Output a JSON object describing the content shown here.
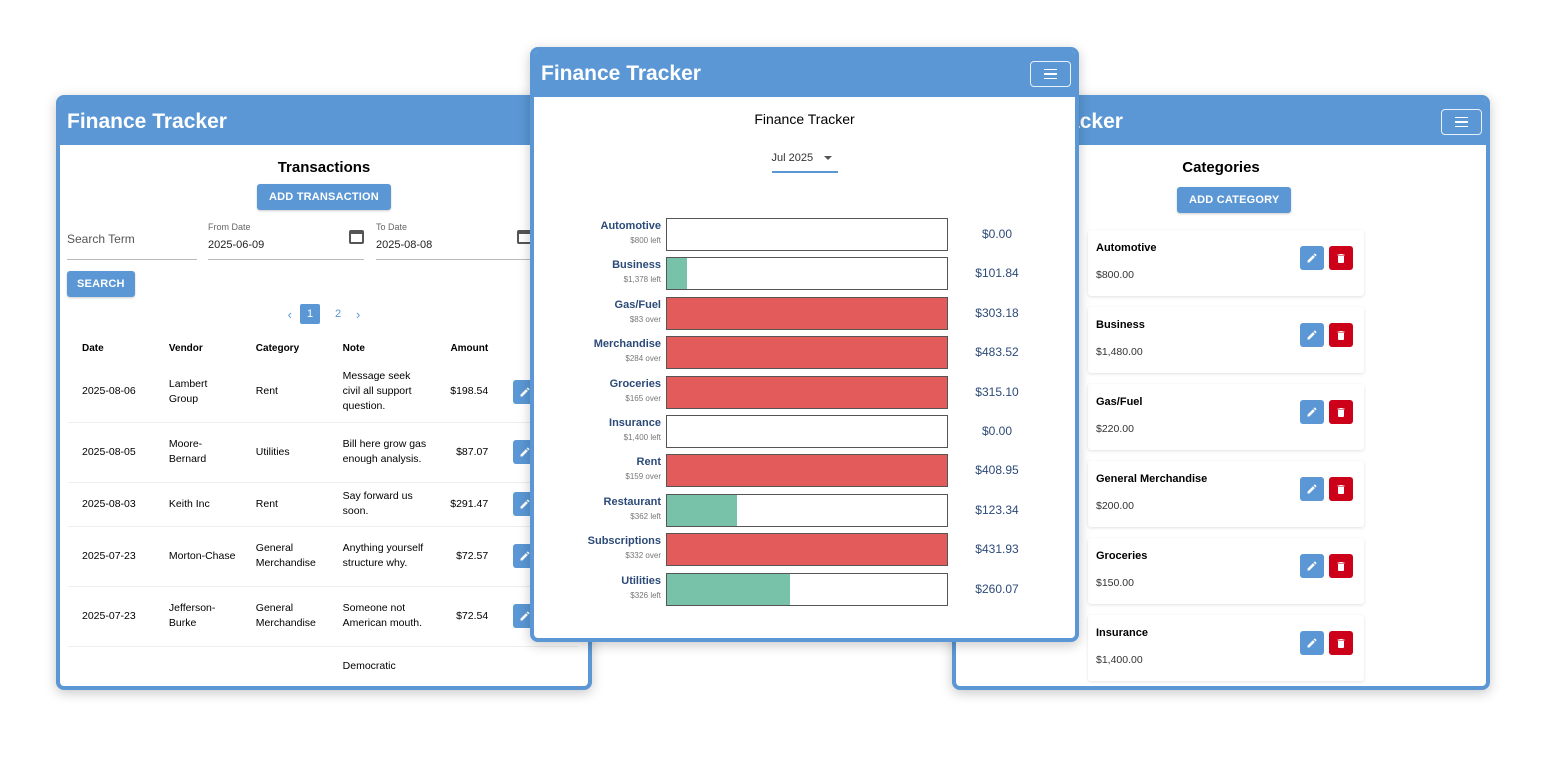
{
  "app_title": "Finance Tracker",
  "colors": {
    "accent": "#5a97d4",
    "delete": "#cc0019",
    "over": "#e35b5b",
    "under": "#79c2aa"
  },
  "transactions_window": {
    "title": "Finance Tracker",
    "heading": "Transactions",
    "add_button": "ADD TRANSACTION",
    "search": {
      "placeholder": "Search Term"
    },
    "from_date": {
      "label": "From Date",
      "value": "2025-06-09"
    },
    "to_date": {
      "label": "To Date",
      "value": "2025-08-08"
    },
    "search_button": "SEARCH",
    "pagination": {
      "pages": [
        "1",
        "2"
      ],
      "current": "1"
    },
    "columns": [
      "Date",
      "Vendor",
      "Category",
      "Note",
      "Amount"
    ],
    "rows": [
      {
        "date": "2025-08-06",
        "vendor": "Lambert Group",
        "category": "Rent",
        "note": "Message seek civil all support question.",
        "amount": "$198.54"
      },
      {
        "date": "2025-08-05",
        "vendor": "Moore-Bernard",
        "category": "Utilities",
        "note": "Bill here grow gas enough analysis.",
        "amount": "$87.07"
      },
      {
        "date": "2025-08-03",
        "vendor": "Keith Inc",
        "category": "Rent",
        "note": "Say forward us soon.",
        "amount": "$291.47"
      },
      {
        "date": "2025-07-23",
        "vendor": "Morton-Chase",
        "category": "General Merchandise",
        "note": "Anything yourself structure why.",
        "amount": "$72.57"
      },
      {
        "date": "2025-07-23",
        "vendor": "Jefferson-Burke",
        "category": "General Merchandise",
        "note": "Someone not American mouth.",
        "amount": "$72.54"
      },
      {
        "date": "",
        "vendor": "",
        "category": "",
        "note": "Democratic",
        "amount": ""
      }
    ]
  },
  "budget_window": {
    "title": "Finance Tracker",
    "heading": "Finance Tracker",
    "month": "Jul 2025",
    "rows": [
      {
        "name": "Automotive",
        "sub": "$800 left",
        "spent": "$0.00",
        "fraction": 0.0,
        "status": "under"
      },
      {
        "name": "Business",
        "sub": "$1,378 left",
        "spent": "$101.84",
        "fraction": 0.07,
        "status": "under"
      },
      {
        "name": "Gas/Fuel",
        "sub": "$83 over",
        "spent": "$303.18",
        "fraction": 1.0,
        "status": "over"
      },
      {
        "name": "Merchandise",
        "sub": "$284 over",
        "spent": "$483.52",
        "fraction": 1.0,
        "status": "over"
      },
      {
        "name": "Groceries",
        "sub": "$165 over",
        "spent": "$315.10",
        "fraction": 1.0,
        "status": "over"
      },
      {
        "name": "Insurance",
        "sub": "$1,400 left",
        "spent": "$0.00",
        "fraction": 0.0,
        "status": "under"
      },
      {
        "name": "Rent",
        "sub": "$159 over",
        "spent": "$408.95",
        "fraction": 1.0,
        "status": "over"
      },
      {
        "name": "Restaurant",
        "sub": "$362 left",
        "spent": "$123.34",
        "fraction": 0.25,
        "status": "under"
      },
      {
        "name": "Subscriptions",
        "sub": "$332 over",
        "spent": "$431.93",
        "fraction": 1.0,
        "status": "over"
      },
      {
        "name": "Utilities",
        "sub": "$326 left",
        "spent": "$260.07",
        "fraction": 0.44,
        "status": "under"
      }
    ]
  },
  "categories_window": {
    "title": "Finance Tracker",
    "heading": "Categories",
    "add_button": "ADD CATEGORY",
    "items": [
      {
        "name": "Automotive",
        "budget": "$800.00"
      },
      {
        "name": "Business",
        "budget": "$1,480.00"
      },
      {
        "name": "Gas/Fuel",
        "budget": "$220.00"
      },
      {
        "name": "General Merchandise",
        "budget": "$200.00"
      },
      {
        "name": "Groceries",
        "budget": "$150.00"
      },
      {
        "name": "Insurance",
        "budget": "$1,400.00"
      }
    ]
  }
}
